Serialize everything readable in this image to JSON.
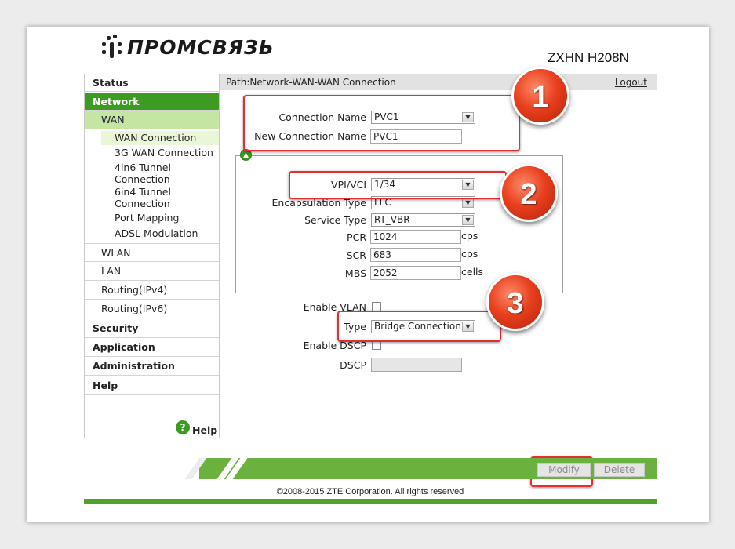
{
  "header": {
    "logo_text": "ПРОМСВЯЗЬ",
    "model": "ZXHN H208N"
  },
  "pathbar": {
    "path": "Path:Network-WAN-WAN Connection",
    "logout": "Logout"
  },
  "sidebar": {
    "status": "Status",
    "network": "Network",
    "wan": "WAN",
    "wan_connection": "WAN Connection",
    "wan3g": "3G WAN Connection",
    "tunnel_4in6_a": "4in6 Tunnel",
    "tunnel_4in6_b": "Connection",
    "tunnel_6in4_a": "6in4 Tunnel",
    "tunnel_6in4_b": "Connection",
    "port_mapping": "Port Mapping",
    "adsl": "ADSL Modulation",
    "wlan": "WLAN",
    "lan": "LAN",
    "routing4": "Routing(IPv4)",
    "routing6": "Routing(IPv6)",
    "security": "Security",
    "application": "Application",
    "administration": "Administration",
    "help": "Help",
    "help_link": "Help",
    "help_icon_glyph": "?"
  },
  "form": {
    "connection_name_label": "Connection Name",
    "connection_name_value": "PVC1",
    "new_connection_name_label": "New Connection Name",
    "new_connection_name_value": "PVC1",
    "vpi_vci_label": "VPI/VCI",
    "vpi_vci_value": "1/34",
    "encapsulation_label": "Encapsulation Type",
    "encapsulation_value": "LLC",
    "service_type_label": "Service Type",
    "service_type_value": "RT_VBR",
    "pcr_label": "PCR",
    "pcr_value": "1024",
    "pcr_unit": "cps",
    "scr_label": "SCR",
    "scr_value": "683",
    "scr_unit": "cps",
    "mbs_label": "MBS",
    "mbs_value": "2052",
    "mbs_unit": "cells",
    "enable_vlan_label": "Enable VLAN",
    "type_label": "Type",
    "type_value": "Bridge Connection",
    "enable_dscp_label": "Enable DSCP",
    "dscp_label": "DSCP",
    "dscp_value": ""
  },
  "buttons": {
    "modify": "Modify",
    "delete": "Delete"
  },
  "annotations": {
    "badge1": "1",
    "badge2": "2",
    "badge3": "3"
  },
  "footer": {
    "copyright": "©2008-2015 ZTE Corporation. All rights reserved"
  },
  "icons": {
    "collapse": "chevron-up-icon",
    "select_arrow": "chevron-down-icon"
  },
  "colors": {
    "accent_green": "#3e9b22",
    "highlight_red": "#e03030"
  }
}
